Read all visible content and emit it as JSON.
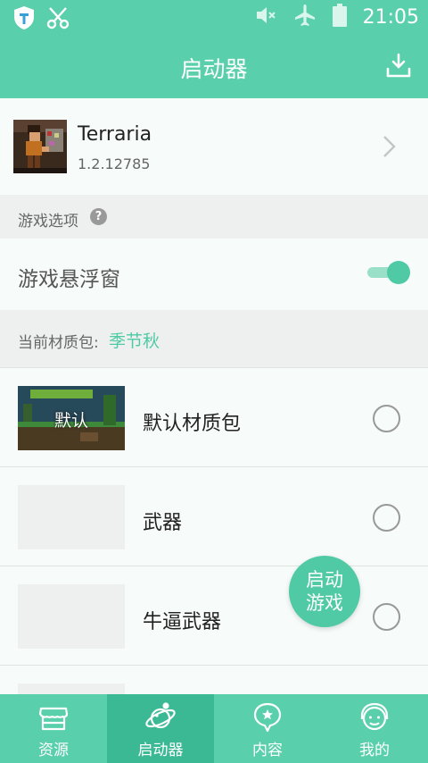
{
  "status_bar": {
    "time": "21:05"
  },
  "header": {
    "title": "启动器"
  },
  "app": {
    "name": "Terraria",
    "version": "1.2.12785"
  },
  "game_options": {
    "section_label": "游戏选项",
    "help_icon": "?"
  },
  "floating_window": {
    "label": "游戏悬浮窗",
    "enabled": true
  },
  "texture": {
    "current_label": "当前材质包:",
    "current_value": "季节秋",
    "packs": [
      {
        "name": "默认材质包",
        "thumb_text": "默认"
      },
      {
        "name": "武器"
      },
      {
        "name": "牛逼武器"
      },
      {
        "name": ""
      }
    ]
  },
  "launch_button": {
    "line1": "启动",
    "line2": "游戏"
  },
  "bottom_nav": [
    {
      "label": "资源",
      "icon": "store-icon"
    },
    {
      "label": "启动器",
      "icon": "planet-icon",
      "active": true
    },
    {
      "label": "内容",
      "icon": "star-bubble-icon"
    },
    {
      "label": "我的",
      "icon": "headset-face-icon"
    }
  ],
  "colors": {
    "brand": "#59cfac",
    "accent": "#4fcaa4",
    "active_tab": "#3bb894"
  }
}
